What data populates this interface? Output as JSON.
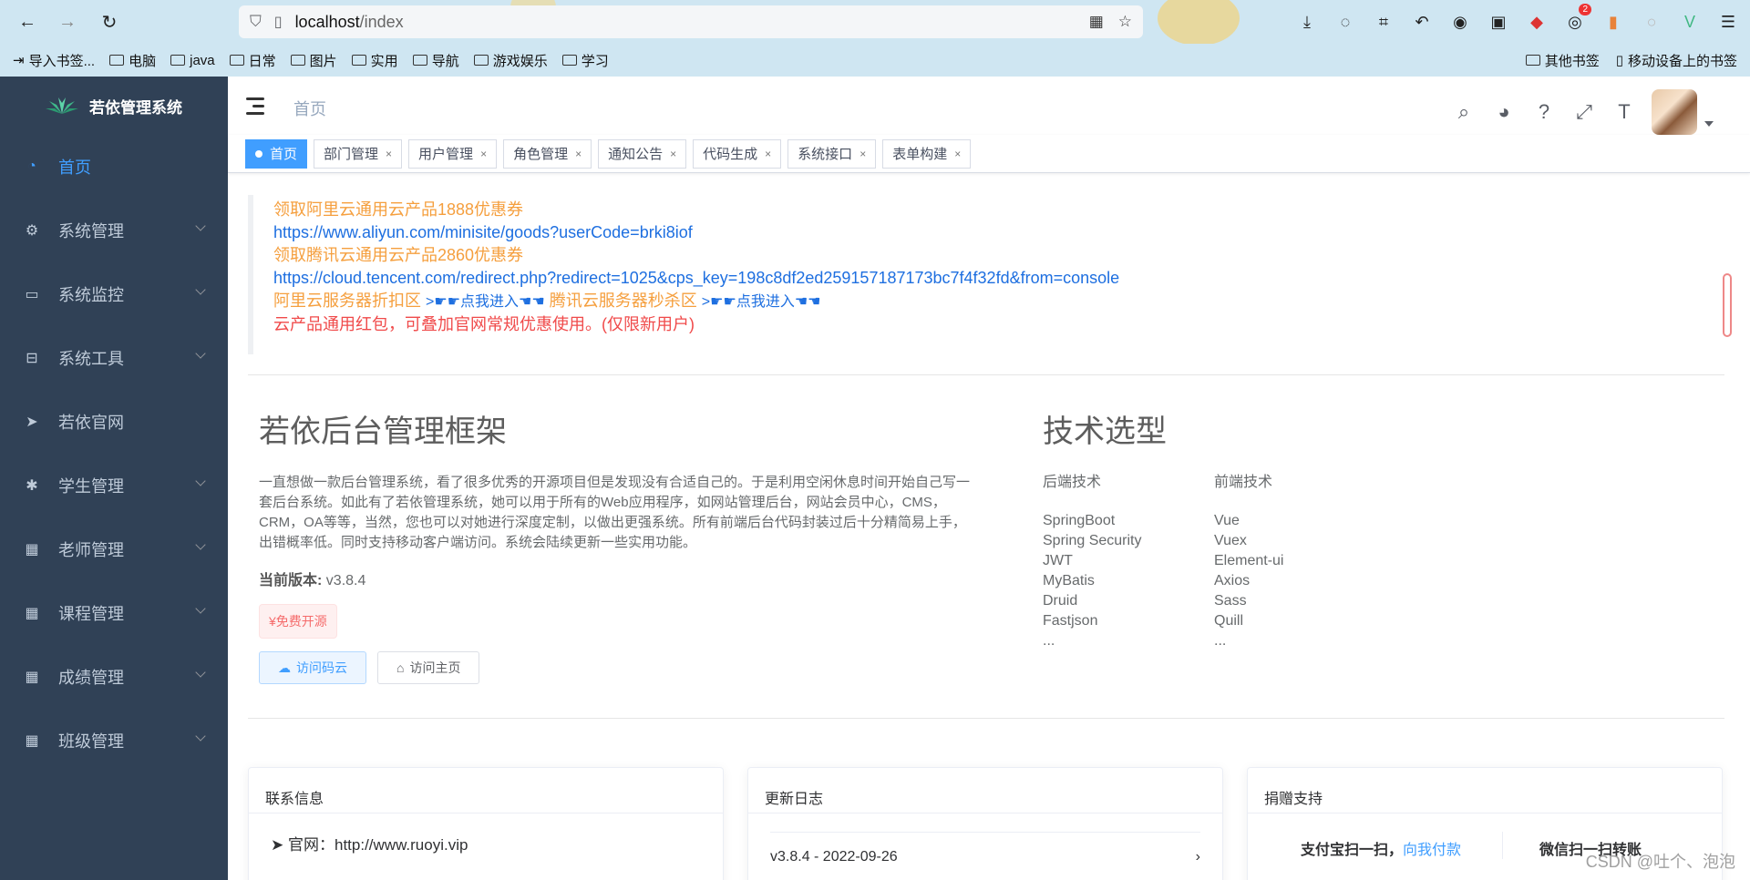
{
  "browser": {
    "url_host": "localhost",
    "url_path": "/index",
    "notification_count": "2"
  },
  "bookmarks": {
    "import_label": "导入书签...",
    "folders": [
      "电脑",
      "java",
      "日常",
      "图片",
      "实用",
      "导航",
      "游戏娱乐",
      "学习"
    ],
    "other": "其他书签",
    "mobile": "移动设备上的书签"
  },
  "sidebar": {
    "title": "若依管理系统",
    "items": [
      {
        "label": "首页",
        "icon": "dashboard-icon"
      },
      {
        "label": "系统管理",
        "icon": "gear-icon"
      },
      {
        "label": "系统监控",
        "icon": "monitor-icon"
      },
      {
        "label": "系统工具",
        "icon": "toolbox-icon"
      },
      {
        "label": "若依官网",
        "icon": "send-icon"
      },
      {
        "label": "学生管理",
        "icon": "bug-icon"
      },
      {
        "label": "老师管理",
        "icon": "table-icon"
      },
      {
        "label": "课程管理",
        "icon": "table-icon"
      },
      {
        "label": "成绩管理",
        "icon": "table-icon"
      },
      {
        "label": "班级管理",
        "icon": "table-icon"
      }
    ]
  },
  "navbar": {
    "breadcrumb": "首页"
  },
  "tags": [
    "首页",
    "部门管理",
    "用户管理",
    "角色管理",
    "通知公告",
    "代码生成",
    "系统接口",
    "表单构建"
  ],
  "promo": {
    "line1": "领取阿里云通用云产品1888优惠券",
    "link1": "https://www.aliyun.com/minisite/goods?userCode=brki8iof",
    "line2": "领取腾讯云通用云产品2860优惠券",
    "link2": "https://cloud.tencent.com/redirect.php?redirect=1025&cps_key=198c8df2ed259157187173bc7f4f32fd&from=console",
    "aliyun_zone": "阿里云服务器折扣区",
    "enter1": ">☛☛点我进入☚☚",
    "tencent_zone": "腾讯云服务器秒杀区",
    "enter2": ">☛☛点我进入☚☚",
    "note": "云产品通用红包，可叠加官网常规优惠使用。(仅限新用户)"
  },
  "intro": {
    "title": "若依后台管理框架",
    "desc": "一直想做一款后台管理系统，看了很多优秀的开源项目但是发现没有合适自己的。于是利用空闲休息时间开始自己写一套后台系统。如此有了若依管理系统，她可以用于所有的Web应用程序，如网站管理后台，网站会员中心，CMS，CRM，OA等等，当然，您也可以对她进行深度定制，以做出更强系统。所有前端后台代码封装过后十分精简易上手，出错概率低。同时支持移动客户端访问。系统会陆续更新一些实用功能。",
    "version_label": "当前版本:",
    "version": "v3.8.4",
    "free_badge": "¥免费开源",
    "btn_gitee": "访问码云",
    "btn_home": "访问主页"
  },
  "tech": {
    "title": "技术选型",
    "backend_head": "后端技术",
    "backend": [
      "SpringBoot",
      "Spring Security",
      "JWT",
      "MyBatis",
      "Druid",
      "Fastjson",
      "..."
    ],
    "frontend_head": "前端技术",
    "frontend": [
      "Vue",
      "Vuex",
      "Element-ui",
      "Axios",
      "Sass",
      "Quill",
      "..."
    ]
  },
  "cards": {
    "contact_title": "联系信息",
    "contact_site_label": "官网：",
    "contact_site": "http://www.ruoyi.vip",
    "changelog_title": "更新日志",
    "changelog_entry": "v3.8.4 - 2022-09-26",
    "donate_title": "捐赠支持",
    "alipay_text": "支付宝扫一扫，",
    "alipay_link": "向我付款",
    "wechat_text": "微信扫一扫转账"
  },
  "watermark": "CSDN @吐个、泡泡"
}
